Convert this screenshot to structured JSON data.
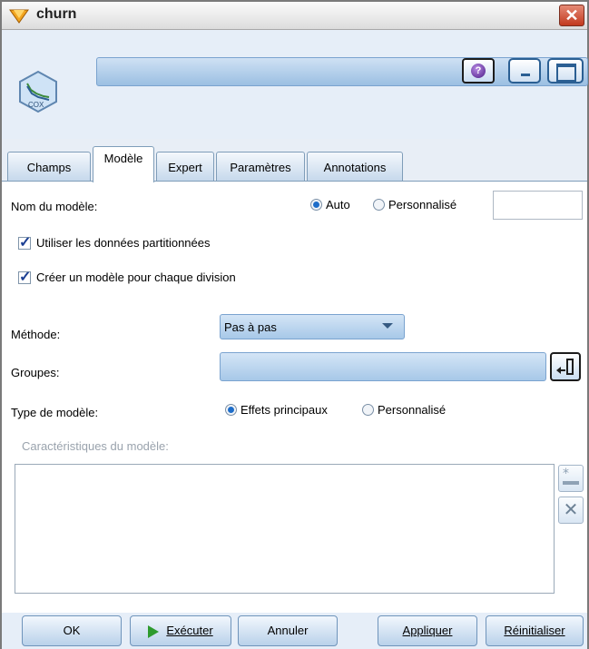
{
  "window": {
    "title": "churn"
  },
  "tabs": [
    {
      "label": "Champs"
    },
    {
      "label": "Modèle"
    },
    {
      "label": "Expert"
    },
    {
      "label": "Paramètres"
    },
    {
      "label": "Annotations"
    }
  ],
  "node_icon": {
    "label": "COX"
  },
  "help_label": "?",
  "model": {
    "name_label": "Nom du modèle:",
    "name_auto": "Auto",
    "name_custom": "Personnalisé",
    "name_value": "",
    "use_partitioned": "Utiliser les données partitionnées",
    "build_per_split": "Créer un modèle pour chaque division",
    "method_label": "Méthode:",
    "method_value": "Pas à pas",
    "groups_label": "Groupes:",
    "groups_value": "",
    "model_type_label": "Type de modèle:",
    "main_effects": "Effets principaux",
    "custom_type": "Personnalisé",
    "model_terms_label": "Caractéristiques du modèle:"
  },
  "footer": {
    "ok": "OK",
    "run": "Exécuter",
    "cancel": "Annuler",
    "apply": "Appliquer",
    "reset": "Réinitialiser"
  },
  "colors": {
    "accent": "#1e6dc9",
    "panel": "#e6eef8",
    "strip": "#9bbfe2"
  }
}
